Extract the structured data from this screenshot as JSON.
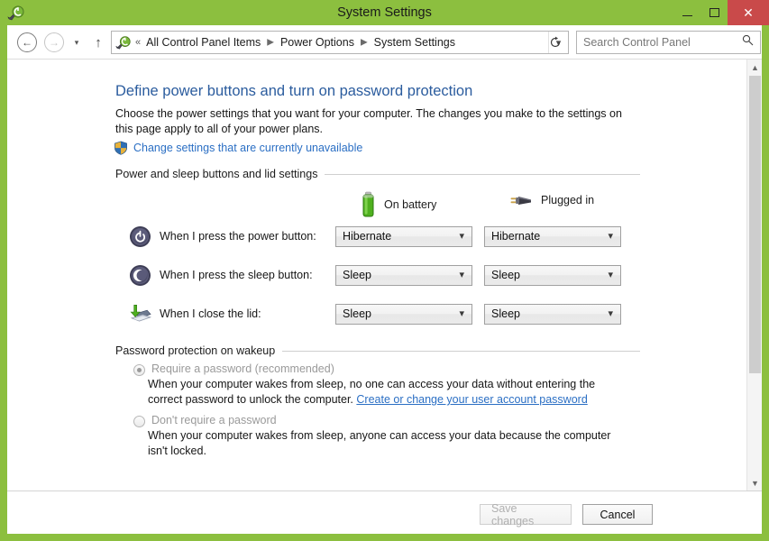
{
  "window": {
    "title": "System Settings",
    "icon": "power-options-icon",
    "controls": {
      "minimize": "minimize-icon",
      "maximize": "maximize-icon",
      "close": "✕"
    },
    "accent_green": "#8cbf3f",
    "close_red": "#c94a4a"
  },
  "navbar": {
    "back": "back-arrow-icon",
    "forward": "forward-arrow-icon",
    "recent": "recent-locations-icon",
    "up": "up-arrow-icon",
    "address_icon": "power-options-icon",
    "address_prefix": "«",
    "breadcrumbs": [
      "All Control Panel Items",
      "Power Options",
      "System Settings"
    ],
    "breadcrumb_separator": "▶",
    "dropdown": "chevron-down-icon",
    "refresh": "refresh-icon",
    "search": {
      "placeholder": "Search Control Panel",
      "icon": "search-icon"
    }
  },
  "page": {
    "title": "Define power buttons and turn on password protection",
    "description": "Choose the power settings that you want for your computer. The changes you make to the settings on this page apply to all of your power plans.",
    "uac_link": "Change settings that are currently unavailable",
    "uac_icon": "shield-icon"
  },
  "power_section": {
    "heading": "Power and sleep buttons and lid settings",
    "columns": [
      {
        "label": "On battery",
        "icon": "battery-icon"
      },
      {
        "label": "Plugged in",
        "icon": "power-plug-icon"
      }
    ],
    "rows": [
      {
        "icon": "power-button-icon",
        "label": "When I press the power button:",
        "on_battery": "Hibernate",
        "plugged_in": "Hibernate"
      },
      {
        "icon": "sleep-button-icon",
        "label": "When I press the sleep button:",
        "on_battery": "Sleep",
        "plugged_in": "Sleep"
      },
      {
        "icon": "close-lid-icon",
        "label": "When I close the lid:",
        "on_battery": "Sleep",
        "plugged_in": "Sleep"
      }
    ],
    "dropdown_arrow": "chevron-down-icon"
  },
  "password_section": {
    "heading": "Password protection on wakeup",
    "options": [
      {
        "label": "Require a password (recommended)",
        "selected": true,
        "description_before": "When your computer wakes from sleep, no one can access your data without entering the correct password to unlock the computer. ",
        "link": "Create or change your user account password",
        "description_after": ""
      },
      {
        "label": "Don't require a password",
        "selected": false,
        "description_before": "When your computer wakes from sleep, anyone can access your data because the computer isn't locked.",
        "link": "",
        "description_after": ""
      }
    ]
  },
  "footer": {
    "save_label": "Save changes",
    "save_enabled": false,
    "cancel_label": "Cancel",
    "cancel_enabled": true
  },
  "scrollbar": {
    "up_arrow": "chevron-up-icon",
    "down_arrow": "chevron-down-icon"
  }
}
